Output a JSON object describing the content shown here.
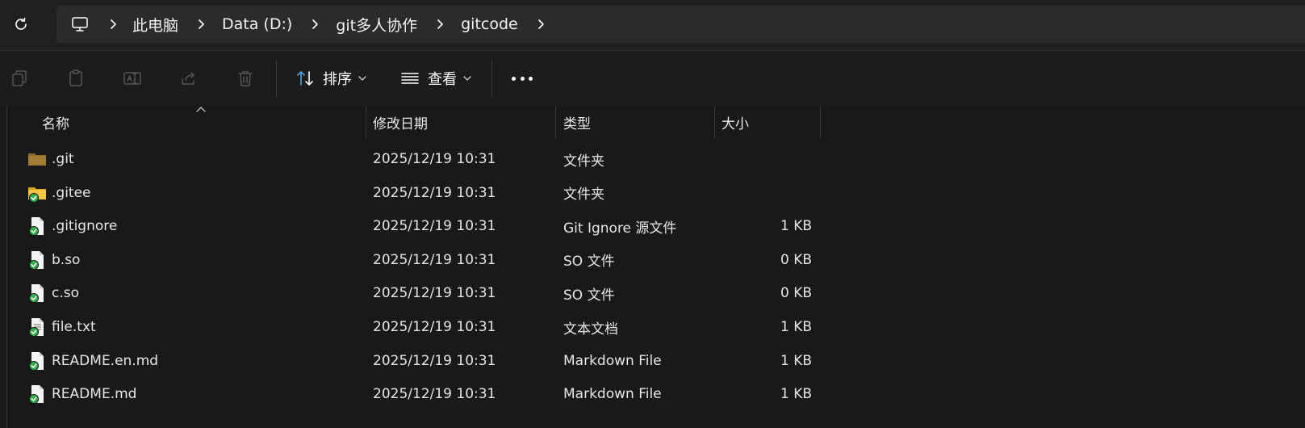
{
  "address": {
    "crumbs": [
      "此电脑",
      "Data (D:)",
      "git多人协作",
      "gitcode"
    ]
  },
  "toolbar": {
    "sort_label": "排序",
    "view_label": "查看"
  },
  "columns": {
    "name": "名称",
    "modified": "修改日期",
    "type": "类型",
    "size": "大小"
  },
  "files": [
    {
      "name": ".git",
      "modified": "2025/12/19 10:31",
      "type": "文件夹",
      "size": "",
      "icon": "folder-dark-icon"
    },
    {
      "name": ".gitee",
      "modified": "2025/12/19 10:31",
      "type": "文件夹",
      "size": "",
      "icon": "folder-synced-icon"
    },
    {
      "name": ".gitignore",
      "modified": "2025/12/19 10:31",
      "type": "Git Ignore 源文件",
      "size": "1 KB",
      "icon": "file-synced-icon"
    },
    {
      "name": "b.so",
      "modified": "2025/12/19 10:31",
      "type": "SO 文件",
      "size": "0 KB",
      "icon": "file-synced-icon"
    },
    {
      "name": "c.so",
      "modified": "2025/12/19 10:31",
      "type": "SO 文件",
      "size": "0 KB",
      "icon": "file-synced-icon"
    },
    {
      "name": "file.txt",
      "modified": "2025/12/19 10:31",
      "type": "文本文档",
      "size": "1 KB",
      "icon": "text-file-synced-icon"
    },
    {
      "name": "README.en.md",
      "modified": "2025/12/19 10:31",
      "type": "Markdown File",
      "size": "1 KB",
      "icon": "file-synced-icon"
    },
    {
      "name": "README.md",
      "modified": "2025/12/19 10:31",
      "type": "Markdown File",
      "size": "1 KB",
      "icon": "file-synced-icon"
    }
  ],
  "colors": {
    "background": "#191919",
    "toolbar": "#1c1c1c",
    "addressbar": "#202020",
    "crumbbox": "#2b2b2b",
    "accent_blue": "#4ca0e0",
    "sync_green": "#2fb14a",
    "folder_yellow": "#e8b83c"
  }
}
